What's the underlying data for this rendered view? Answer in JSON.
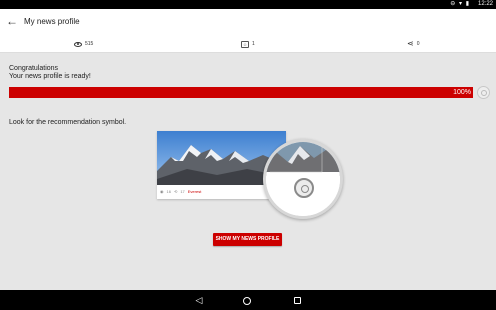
{
  "status_bar": {
    "time": "12:22",
    "icons": [
      "do-not-disturb-icon",
      "wifi-icon",
      "battery-icon"
    ]
  },
  "app_bar": {
    "back_icon": "arrow-back-icon",
    "title": "My news profile"
  },
  "stats": {
    "views_icon": "eye-icon",
    "views": "515",
    "smiley_icon": "smiley-icon",
    "smileys": "1",
    "share_icon": "share-icon",
    "shares": "0"
  },
  "congrats": {
    "line1": "Congratulations",
    "line2": "Your news profile is ready!"
  },
  "progress": {
    "value_fraction": 1.0,
    "label": "100%",
    "color": "#cc0000"
  },
  "hint": {
    "text": "Look for the recommendation symbol."
  },
  "sample_card": {
    "views": "16",
    "comments": "17",
    "tag": "Everest"
  },
  "actions": {
    "show_profile_label": "SHOW MY NEWS PROFILE"
  },
  "colors": {
    "accent": "#cc0000",
    "background": "#e6e6e6"
  },
  "nav_bar": {
    "icons": [
      "nav-back-icon",
      "nav-home-icon",
      "nav-recents-icon"
    ]
  }
}
